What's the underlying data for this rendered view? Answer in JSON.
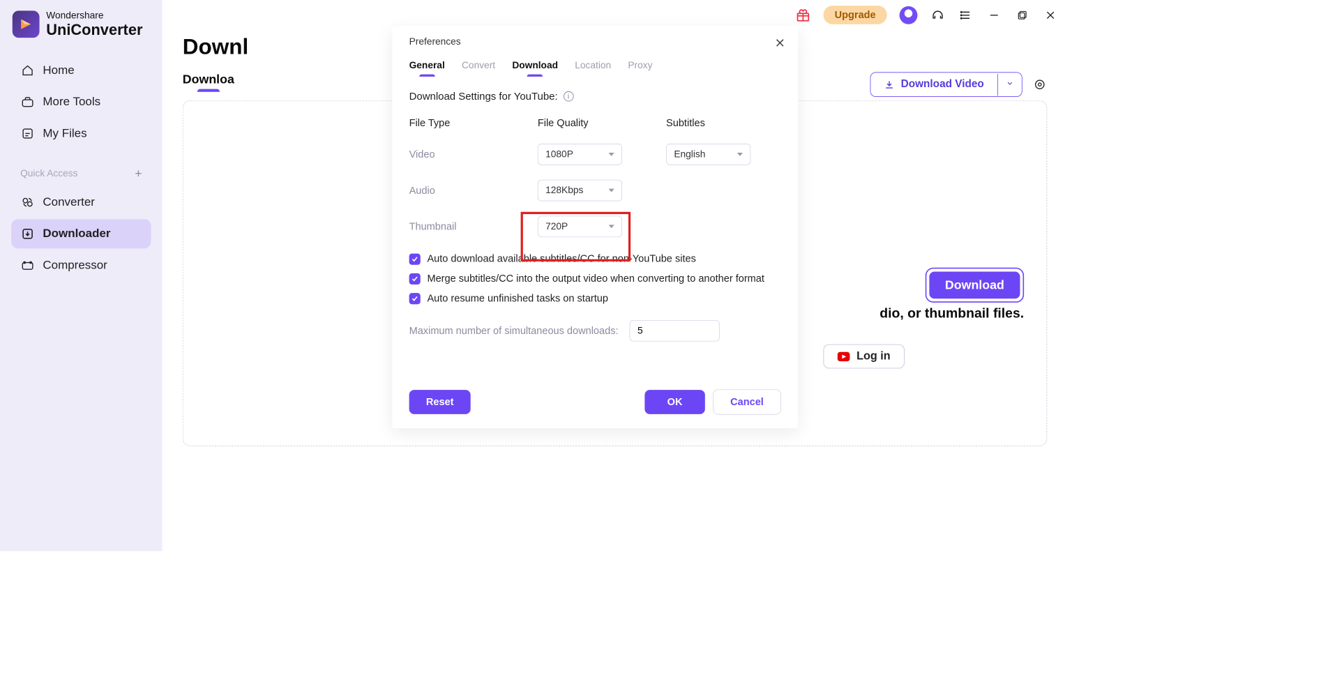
{
  "brand": {
    "sub": "Wondershare",
    "main": "UniConverter"
  },
  "nav": {
    "home": "Home",
    "more_tools": "More Tools",
    "my_files": "My Files",
    "quick_access": "Quick Access",
    "converter": "Converter",
    "downloader": "Downloader",
    "compressor": "Compressor"
  },
  "titlebar": {
    "upgrade": "Upgrade"
  },
  "page": {
    "title_partial": "Downl",
    "tab_partial": "Downloa"
  },
  "header_actions": {
    "download_video": "Download Video"
  },
  "content": {
    "download": "Download",
    "hint_partial": "dio, or thumbnail files.",
    "login": "Log in"
  },
  "modal": {
    "title": "Preferences",
    "tabs": {
      "general": "General",
      "convert": "Convert",
      "download": "Download",
      "location": "Location",
      "proxy": "Proxy"
    },
    "section": "Download Settings for YouTube:",
    "headers": {
      "file_type": "File Type",
      "file_quality": "File Quality",
      "subtitles": "Subtitles"
    },
    "rows": {
      "video": "Video",
      "video_quality": "1080P",
      "subtitles_value": "English",
      "audio": "Audio",
      "audio_quality": "128Kbps",
      "thumbnail": "Thumbnail",
      "thumbnail_quality": "720P"
    },
    "checks": {
      "c1": "Auto download available subtitles/CC for non-YouTube sites",
      "c2": "Merge subtitles/CC into the output video when converting to another format",
      "c3": "Auto resume unfinished tasks on startup"
    },
    "max_label": "Maximum number of simultaneous downloads:",
    "max_value": "5",
    "buttons": {
      "reset": "Reset",
      "ok": "OK",
      "cancel": "Cancel"
    }
  }
}
